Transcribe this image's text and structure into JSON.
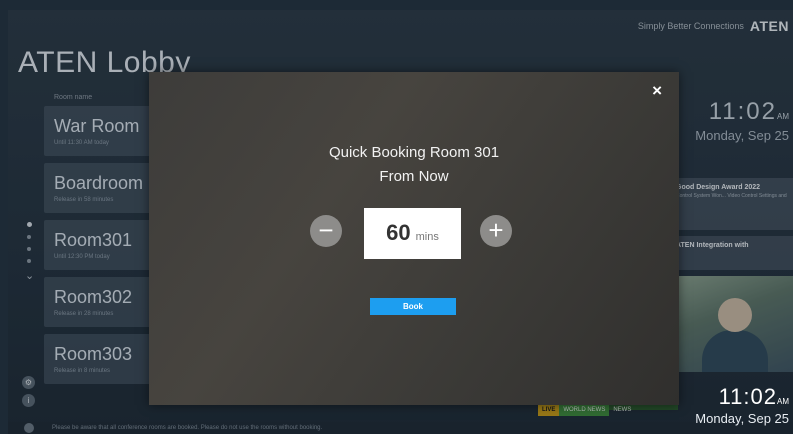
{
  "brand": {
    "tagline": "Simply Better Connections",
    "logo": "ATEN"
  },
  "lobby": {
    "title": "ATEN Lobby",
    "column_header": "Room name"
  },
  "rooms": [
    {
      "name": "War Room",
      "status": "Until 11:30 AM today"
    },
    {
      "name": "Boardroom",
      "status": "Release in 58 minutes"
    },
    {
      "name": "Room301",
      "status": "Until 12:30 PM today"
    },
    {
      "name": "Room302",
      "status": "Release in 28 minutes"
    },
    {
      "name": "Room303",
      "status": "Release in 8 minutes"
    }
  ],
  "clock": {
    "time": "11:02",
    "ampm": "AM",
    "date": "Monday, Sep 25"
  },
  "news": [
    {
      "headline": "Good Design Award 2022",
      "body": "Control System Won... Video Control Settings and"
    },
    {
      "headline": "ATEN Integration with",
      "body": ""
    }
  ],
  "ticker": {
    "items": [
      "LIVE",
      "WORLD NEWS",
      "NEWS"
    ]
  },
  "bottom_bar": {
    "text": "Please be aware that all conference rooms are booked. Please do not use the rooms without booking."
  },
  "dialog": {
    "title": "Quick Booking Room 301",
    "subtitle": "From Now",
    "close_glyph": "×",
    "minus_glyph": "−",
    "plus_glyph": "+",
    "duration_value": "60",
    "duration_unit": "mins",
    "book_label": "Book"
  },
  "colors": {
    "book_button": "#1d9ef0",
    "dialog_bg": "#3f3d3a",
    "stepper": "#8d8c8a"
  },
  "icons": {
    "close": "close-icon",
    "minus": "minus-icon",
    "plus": "plus-icon",
    "chevron": "chevron-down-icon"
  }
}
